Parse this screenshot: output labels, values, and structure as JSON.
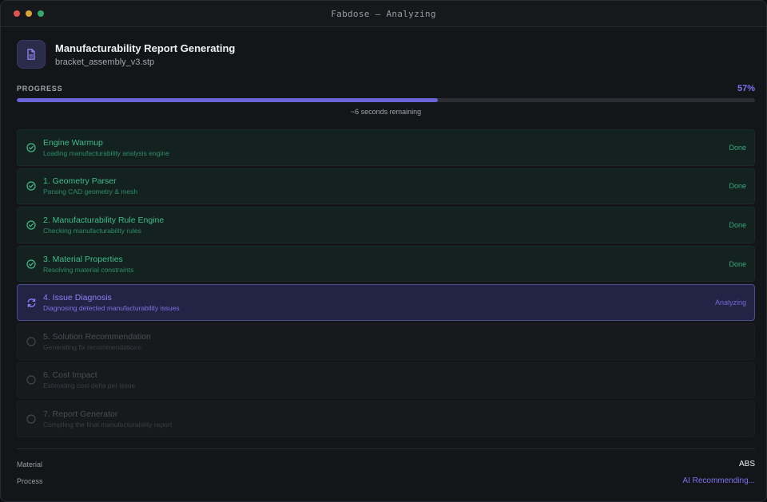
{
  "window": {
    "title": "Fabdose — Analyzing"
  },
  "header": {
    "icon": "document-icon",
    "title": "Manufacturability Report Generating",
    "file": "bracket_assembly_v3.stp"
  },
  "progress": {
    "label": "PROGRESS",
    "percent_text": "57%",
    "value": 0.57,
    "remaining": "~6 seconds remaining"
  },
  "colors": {
    "accent": "#6b64d8",
    "done": "#3dbc8a",
    "pending": "#4b4d54"
  },
  "steps": [
    {
      "name": "Engine Warmup",
      "desc": "Loading manufacturability analysis engine",
      "state": "done",
      "status": "Done",
      "icon": "check-circle-icon"
    },
    {
      "name": "1. Geometry Parser",
      "desc": "Parsing CAD geometry & mesh",
      "state": "done",
      "status": "Done",
      "icon": "check-circle-icon"
    },
    {
      "name": "2. Manufacturability Rule Engine",
      "desc": "Checking manufacturability rules",
      "state": "done",
      "status": "Done",
      "icon": "check-circle-icon"
    },
    {
      "name": "3. Material Properties",
      "desc": "Resolving material constraints",
      "state": "done",
      "status": "Done",
      "icon": "check-circle-icon"
    },
    {
      "name": "4. Issue Diagnosis",
      "desc": "Diagnosing detected manufacturability issues",
      "state": "active",
      "status": "Analyzing",
      "icon": "refresh-icon"
    },
    {
      "name": "5. Solution Recommendation",
      "desc": "Generating fix recommendations",
      "state": "pending",
      "status": "",
      "icon": "empty-circle-icon"
    },
    {
      "name": "6. Cost Impact",
      "desc": "Estimating cost delta per issue",
      "state": "pending",
      "status": "",
      "icon": "empty-circle-icon"
    },
    {
      "name": "7. Report Generator",
      "desc": "Compiling the final manufacturability report",
      "state": "pending",
      "status": "",
      "icon": "empty-circle-icon"
    }
  ],
  "meta": {
    "material_label": "Material",
    "material_value": "ABS",
    "process_label": "Process",
    "process_value": "AI Recommending..."
  }
}
